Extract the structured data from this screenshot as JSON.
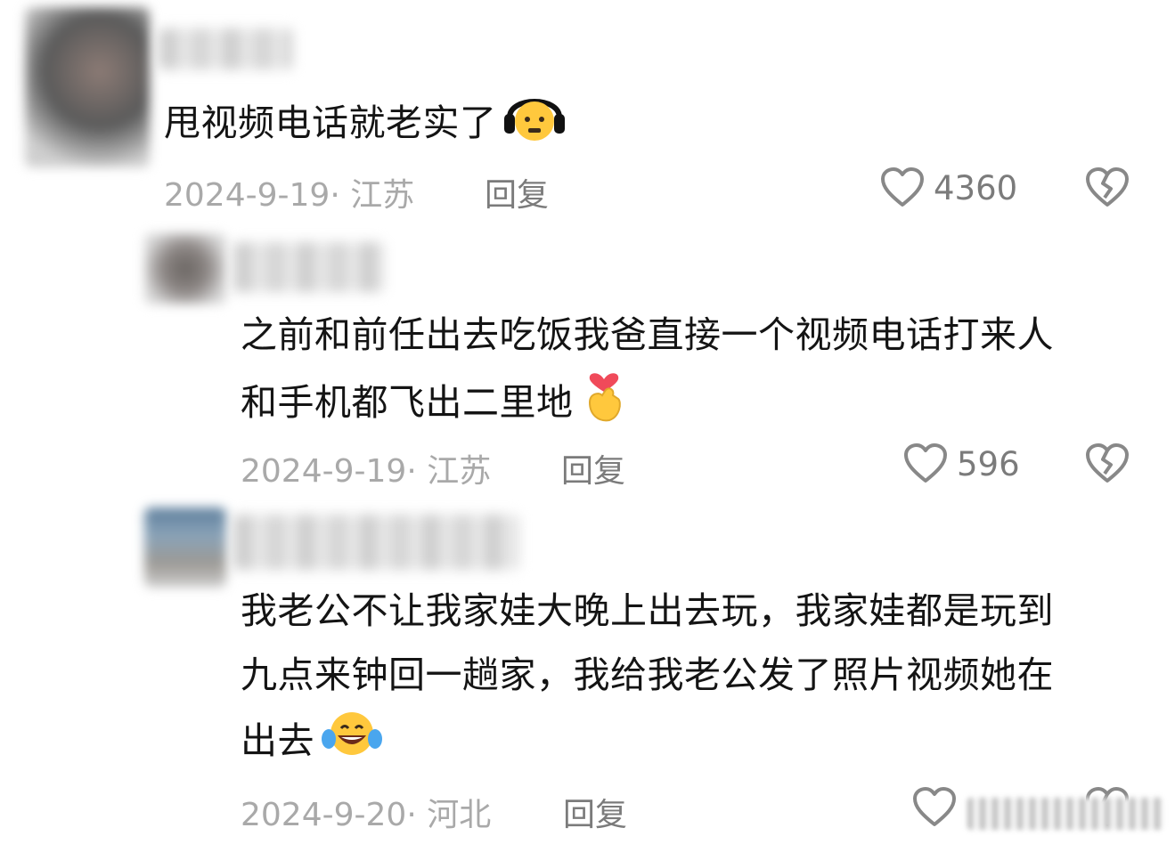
{
  "comments": [
    {
      "text_lines": [
        "甩视频电话就老实了"
      ],
      "emoji": "worried-face-headphones",
      "date": "2024-9-19",
      "location": "江苏",
      "reply_label": "回复",
      "likes": "4360"
    },
    {
      "text_lines": [
        "之前和前任出去吃饭我爸直接一个视频电话打来人",
        "和手机都飞出二里地"
      ],
      "emoji": "finger-heart",
      "date": "2024-9-19",
      "location": "江苏",
      "reply_label": "回复",
      "likes": "596"
    },
    {
      "text_lines": [
        "我老公不让我家娃大晚上出去玩，我家娃都是玩到",
        "九点来钟回一趟家，我给我老公发了照片视频她在",
        "出去"
      ],
      "emoji": "laughing-tears",
      "date": "2024-9-20",
      "location": "河北",
      "reply_label": "回复",
      "likes": ""
    }
  ],
  "meta_separator": "· ",
  "icons": {
    "like": "heart-outline-icon",
    "dislike": "broken-heart-icon"
  }
}
